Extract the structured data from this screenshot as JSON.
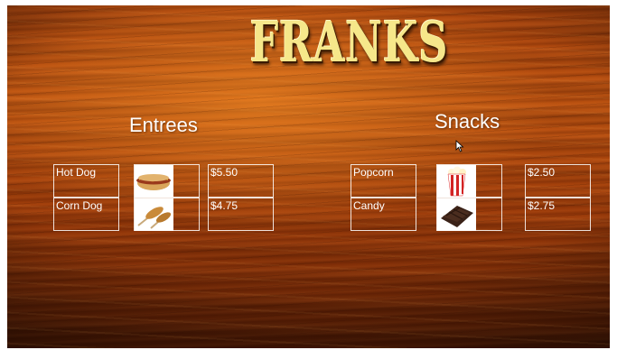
{
  "logo": {
    "text": "FRANKS"
  },
  "sections": [
    {
      "heading": "Entrees",
      "items": [
        {
          "name": "Hot Dog",
          "price": "$5.50",
          "icon": "hot-dog-icon"
        },
        {
          "name": "Corn Dog",
          "price": "$4.75",
          "icon": "corn-dog-icon"
        }
      ]
    },
    {
      "heading": "Snacks",
      "items": [
        {
          "name": "Popcorn",
          "price": "$2.50",
          "icon": "popcorn-icon"
        },
        {
          "name": "Candy",
          "price": "$2.75",
          "icon": "candy-icon"
        }
      ]
    }
  ],
  "colors": {
    "logo": "#f6e78a",
    "text": "#ffffff",
    "wood": "#a8420c"
  }
}
